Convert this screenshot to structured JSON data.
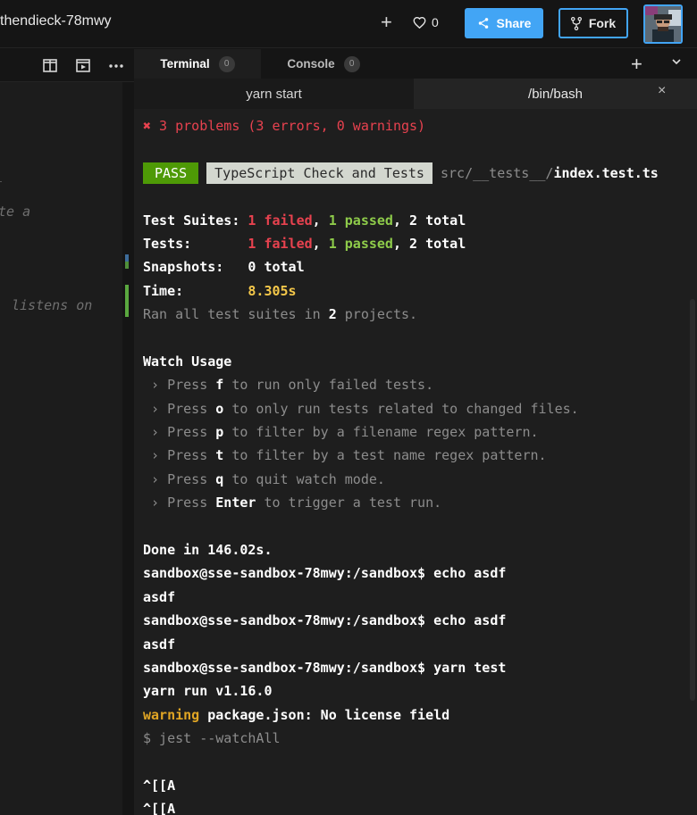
{
  "header": {
    "repo_title": "thendieck-78mwy",
    "plus": "+",
    "likes": "0",
    "share_label": "Share",
    "fork_label": "Fork"
  },
  "left_panel": {
    "code_fragments": [
      "te a",
      "listens on"
    ]
  },
  "terminal": {
    "tabs": [
      {
        "label": "Terminal",
        "count": "0"
      },
      {
        "label": "Console",
        "count": "0"
      }
    ],
    "add": "+",
    "subtabs": [
      "yarn start",
      "/bin/bash"
    ],
    "close": "×",
    "output": {
      "problems": "✖ 3 problems (3 errors, 0 warnings)",
      "pass": "PASS",
      "suite": "TypeScript Check and Tests",
      "path_dir": "src/__tests__/",
      "path_file": "index.test.ts",
      "test_suites_label": "Test Suites: ",
      "tests_label": "Tests:       ",
      "failed": "1 failed",
      "passed": "1 passed",
      "total_2": "2 total",
      "sep": ", ",
      "snapshots": "Snapshots:   0 total",
      "time_label": "Time:        ",
      "time_value": "8.305s",
      "ran_pre": "Ran all test suites in ",
      "ran_num": "2",
      "ran_post": " projects.",
      "watch_usage": "Watch Usage",
      "watch_items": [
        {
          "pre": " › Press ",
          "key": "f",
          "post": " to run only failed tests."
        },
        {
          "pre": " › Press ",
          "key": "o",
          "post": " to only run tests related to changed files."
        },
        {
          "pre": " › Press ",
          "key": "p",
          "post": " to filter by a filename regex pattern."
        },
        {
          "pre": " › Press ",
          "key": "t",
          "post": " to filter by a test name regex pattern."
        },
        {
          "pre": " › Press ",
          "key": "q",
          "post": " to quit watch mode."
        },
        {
          "pre": " › Press ",
          "key": "Enter",
          "post": " to trigger a test run."
        }
      ],
      "done": "Done in 146.02s.",
      "cmd1": "sandbox@sse-sandbox-78mwy:/sandbox$ echo asdf",
      "out1": "asdf",
      "cmd2": "sandbox@sse-sandbox-78mwy:/sandbox$ echo asdf",
      "out2": "asdf",
      "cmd3": "sandbox@sse-sandbox-78mwy:/sandbox$ yarn test",
      "yarn_run": "yarn run v1.16.0",
      "warning": "warning",
      "warning_msg": " package.json: No license field",
      "jest_cmd": "$ jest --watchAll",
      "esc1": "^[[A",
      "esc2": "^[[A"
    }
  },
  "colors": {
    "accent": "#42a5f5",
    "error": "#e8424f",
    "success": "#8ecb4a",
    "highlight": "#f5c84a",
    "pass_bg": "#4e9a06"
  }
}
